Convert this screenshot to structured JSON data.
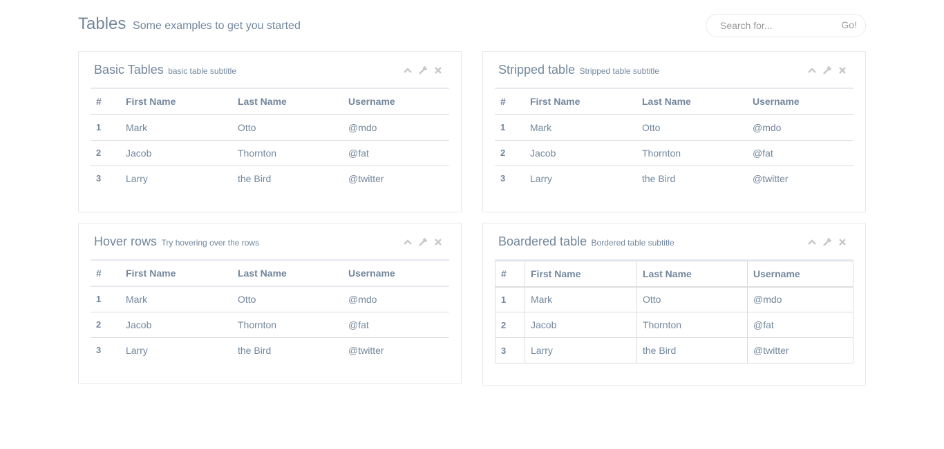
{
  "header": {
    "title": "Tables",
    "subtitle": "Some examples to get you started",
    "search": {
      "placeholder": "Search for...",
      "button": "Go!"
    }
  },
  "panels": [
    {
      "title": "Basic Tables",
      "subtitle": "basic table subtitle",
      "columns": [
        "#",
        "First Name",
        "Last Name",
        "Username"
      ],
      "rows": [
        [
          "1",
          "Mark",
          "Otto",
          "@mdo"
        ],
        [
          "2",
          "Jacob",
          "Thornton",
          "@fat"
        ],
        [
          "3",
          "Larry",
          "the Bird",
          "@twitter"
        ]
      ]
    },
    {
      "title": "Stripped table",
      "subtitle": "Stripped table subtitle",
      "columns": [
        "#",
        "First Name",
        "Last Name",
        "Username"
      ],
      "rows": [
        [
          "1",
          "Mark",
          "Otto",
          "@mdo"
        ],
        [
          "2",
          "Jacob",
          "Thornton",
          "@fat"
        ],
        [
          "3",
          "Larry",
          "the Bird",
          "@twitter"
        ]
      ]
    },
    {
      "title": "Hover rows",
      "subtitle": "Try hovering over the rows",
      "columns": [
        "#",
        "First Name",
        "Last Name",
        "Username"
      ],
      "rows": [
        [
          "1",
          "Mark",
          "Otto",
          "@mdo"
        ],
        [
          "2",
          "Jacob",
          "Thornton",
          "@fat"
        ],
        [
          "3",
          "Larry",
          "the Bird",
          "@twitter"
        ]
      ]
    },
    {
      "title": "Boardered table",
      "subtitle": "Bordered table subtitle",
      "columns": [
        "#",
        "First Name",
        "Last Name",
        "Username"
      ],
      "rows": [
        [
          "1",
          "Mark",
          "Otto",
          "@mdo"
        ],
        [
          "2",
          "Jacob",
          "Thornton",
          "@fat"
        ],
        [
          "3",
          "Larry",
          "the Bird",
          "@twitter"
        ]
      ]
    }
  ],
  "tool_icons": [
    "chevron-up-icon",
    "wrench-icon",
    "close-icon"
  ],
  "colors": {
    "text": "#73879c",
    "border": "#e6e9ed",
    "icon": "#c5c7cb"
  }
}
